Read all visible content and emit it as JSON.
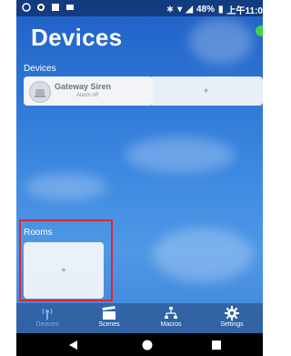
{
  "status_bar": {
    "battery": "48%",
    "time": "上午11:0"
  },
  "header": {
    "title": "Devices"
  },
  "devices_section": {
    "label": "Devices",
    "items": [
      {
        "name": "Gateway Siren",
        "status": "Alarm off"
      }
    ],
    "add_label": "+"
  },
  "rooms_section": {
    "label": "Rooms",
    "add_label": "+"
  },
  "tabs": [
    {
      "label": "Devices",
      "icon": "devices-icon",
      "active": true
    },
    {
      "label": "Scenes",
      "icon": "scenes-icon",
      "active": false
    },
    {
      "label": "Macros",
      "icon": "macros-icon",
      "active": false
    },
    {
      "label": "Settings",
      "icon": "gear-icon",
      "active": false
    }
  ],
  "colors": {
    "accent_active_tab": "#6fb6ff",
    "highlight": "#e0262f",
    "online_dot": "#3fd24a"
  }
}
